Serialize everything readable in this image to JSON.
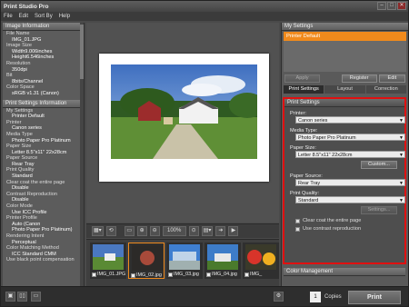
{
  "window": {
    "title": "Print Studio Pro",
    "min": "–",
    "max": "□",
    "close": "✕"
  },
  "menu": [
    "File",
    "Edit",
    "Sort By",
    "Help"
  ],
  "left": {
    "image_info": {
      "header": "Image Information",
      "rows": [
        {
          "k": "File Name",
          "v": "IMG_01.JPG"
        },
        {
          "k": "Image Size",
          "v": "Width9.006inches"
        },
        {
          "k": "",
          "v": "Height6.546inches"
        },
        {
          "k": "Resolution",
          "v": "350dpi"
        },
        {
          "k": "Bit",
          "v": "8bits/Channel"
        },
        {
          "k": "Color Space",
          "v": "sRGB v1.31 (Canon)"
        }
      ]
    },
    "print_info": {
      "header": "Print Settings Information",
      "rows": [
        {
          "k": "My Settings",
          "v": "Printer Default"
        },
        {
          "k": "Printer",
          "v": "Canon series"
        },
        {
          "k": "Media Type",
          "v": "Photo Paper Pro Platinum"
        },
        {
          "k": "Paper Size",
          "v": "Letter 8.5\"x11\" 22x28cm"
        },
        {
          "k": "Paper Source",
          "v": "Rear Tray"
        },
        {
          "k": "Print Quality",
          "v": "Standard"
        },
        {
          "k": "Clear coat the entire page",
          "v": "Disable"
        },
        {
          "k": "Contrast Reproduction",
          "v": "Disable"
        },
        {
          "k": "Color Mode",
          "v": "Use ICC Profile"
        },
        {
          "k": "Printer Profile",
          "v": "Auto (Canon"
        },
        {
          "k": "",
          "v": "Photo Paper Pro Platinum)"
        },
        {
          "k": "Rendering Intent",
          "v": "Perceptual"
        },
        {
          "k": "Color Matching Method",
          "v": "ICC Standard CMM"
        },
        {
          "k": "Use black point compensation",
          "v": ""
        }
      ]
    }
  },
  "toolbar": {
    "zoom_value": "100%",
    "icons": [
      "layout-icon",
      "rotate-icon",
      "preview-icon",
      "zoom-in-icon",
      "zoom-out-icon",
      "zoom-icon",
      "fit-icon",
      "arrange-icon",
      "next-icon",
      "move-icon"
    ]
  },
  "thumbnails": [
    {
      "label": "IMG_01.JPG"
    },
    {
      "label": "IMG_02.jpg"
    },
    {
      "label": "IMG_03.jpg"
    },
    {
      "label": "IMG_04.jpg"
    },
    {
      "label": "IMG_"
    }
  ],
  "right": {
    "my_settings": {
      "header": "My Settings",
      "selected": "Printer Default"
    },
    "buttons": {
      "apply": "Apply",
      "register": "Register",
      "edit": "Edit"
    },
    "tabs": [
      "Print Settings",
      "Layout",
      "Correction"
    ],
    "panel_header": "Print Settings",
    "printer": {
      "label": "Printer:",
      "value": "Canon series"
    },
    "media": {
      "label": "Media Type:",
      "value": "Photo Paper Pro Platinum"
    },
    "paper_size": {
      "label": "Paper Size:",
      "value": "Letter 8.5\"x11\" 22x28cm"
    },
    "custom_btn": "Custom...",
    "paper_source": {
      "label": "Paper Source:",
      "value": "Rear Tray"
    },
    "quality": {
      "label": "Print Quality:",
      "value": "Standard"
    },
    "settings_btn": "Settings...",
    "clear_coat": "Clear coat the entire page",
    "contrast": "Use contrast reproduction",
    "color_mgmt": "Color Management"
  },
  "bottom": {
    "copies_value": "1",
    "copies_label": "Copies",
    "print": "Print"
  },
  "accent": "#f08a1c",
  "highlight": "#e01010"
}
